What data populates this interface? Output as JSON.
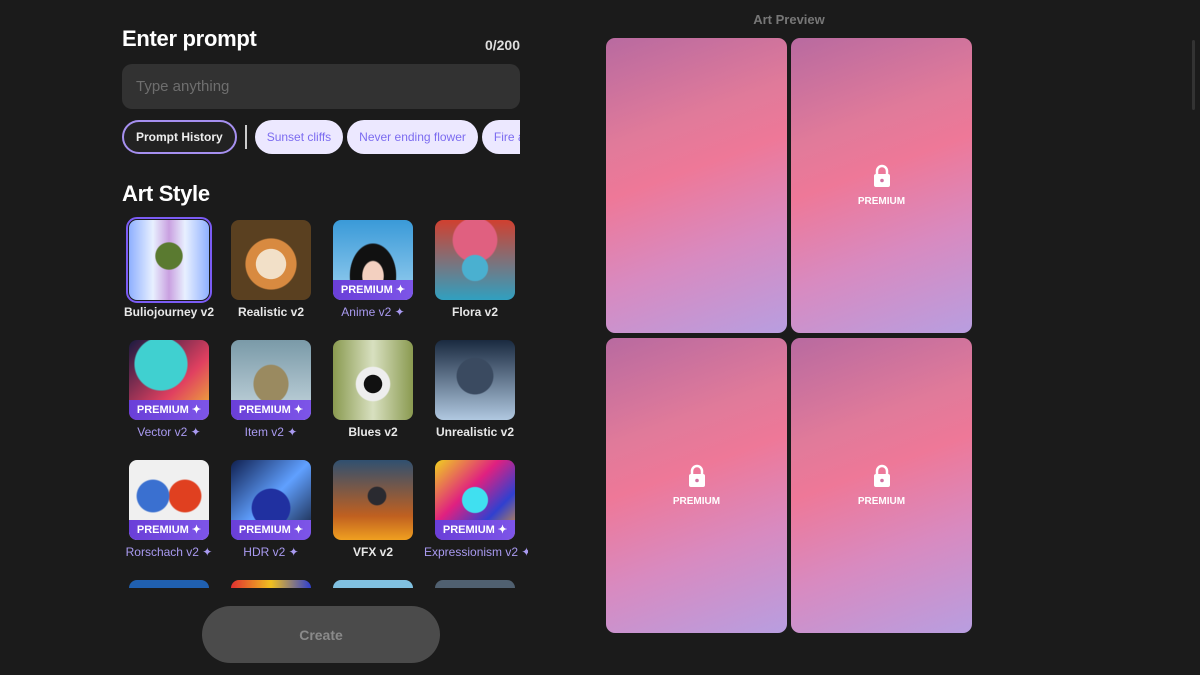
{
  "prompt": {
    "title": "Enter prompt",
    "counter": "0/200",
    "placeholder": "Type anything",
    "value": ""
  },
  "chips": {
    "history": "Prompt History",
    "suggestions": [
      "Sunset cliffs",
      "Never ending flower",
      "Fire and water"
    ]
  },
  "art_style": {
    "title": "Art Style",
    "premium_label": "PREMIUM ✦",
    "styles": [
      {
        "name": "Buliojourney v2",
        "premium": false,
        "selected": true
      },
      {
        "name": "Realistic v2",
        "premium": false
      },
      {
        "name": "Anime v2 ✦",
        "premium": true
      },
      {
        "name": "Flora v2",
        "premium": false
      },
      {
        "name": "Vector v2 ✦",
        "premium": true
      },
      {
        "name": "Item v2 ✦",
        "premium": true
      },
      {
        "name": "Blues v2",
        "premium": false
      },
      {
        "name": "Unrealistic v2",
        "premium": false
      },
      {
        "name": "Rorschach v2 ✦",
        "premium": true
      },
      {
        "name": "HDR v2 ✦",
        "premium": true
      },
      {
        "name": "VFX v2",
        "premium": false
      },
      {
        "name": "Expressionism v2 ✦",
        "premium": true
      }
    ]
  },
  "create_label": "Create",
  "preview": {
    "title": "Art Preview",
    "premium_label": "PREMIUM",
    "panels": [
      {
        "locked": false
      },
      {
        "locked": true
      },
      {
        "locked": true
      },
      {
        "locked": true
      }
    ]
  },
  "colors": {
    "accent": "#7b5cf5",
    "background": "#1b1b1b"
  }
}
